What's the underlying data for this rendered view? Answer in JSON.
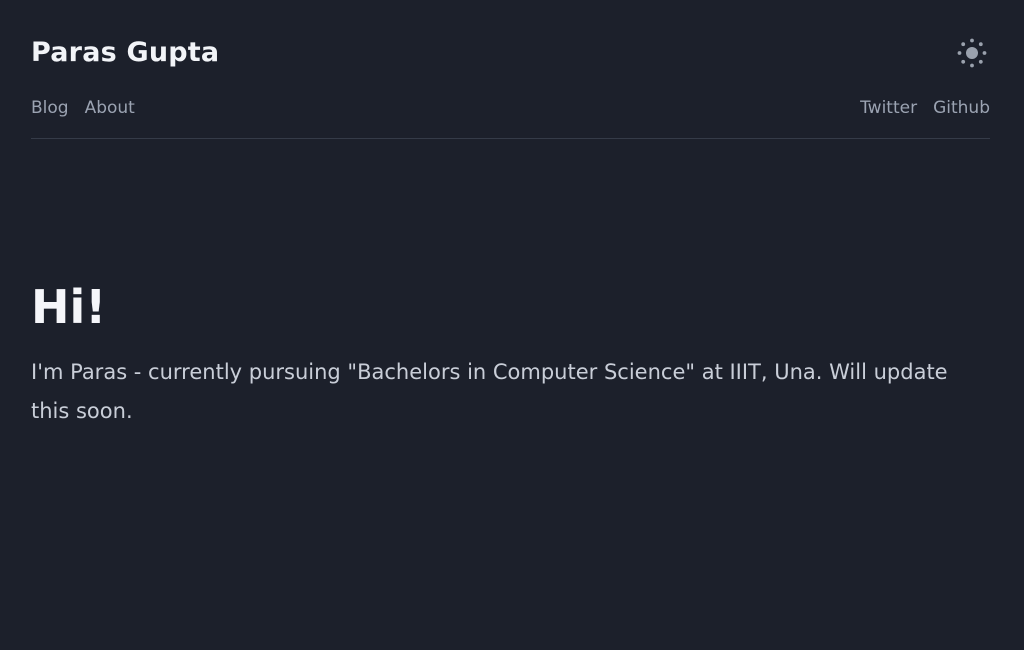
{
  "header": {
    "site_title": "Paras Gupta",
    "theme_icon": "sun-icon"
  },
  "nav": {
    "left": [
      {
        "label": "Blog"
      },
      {
        "label": "About"
      }
    ],
    "right": [
      {
        "label": "Twitter"
      },
      {
        "label": "Github"
      }
    ]
  },
  "main": {
    "heading": "Hi!",
    "intro": "I'm Paras - currently pursuing \"Bachelors in Computer Science\" at IIIT, Una. Will update this soon."
  },
  "colors": {
    "background": "#1c202b",
    "title": "#f2f4f8",
    "link": "#9ba3b2",
    "body_text": "#c9ced8",
    "divider": "#353b48"
  }
}
